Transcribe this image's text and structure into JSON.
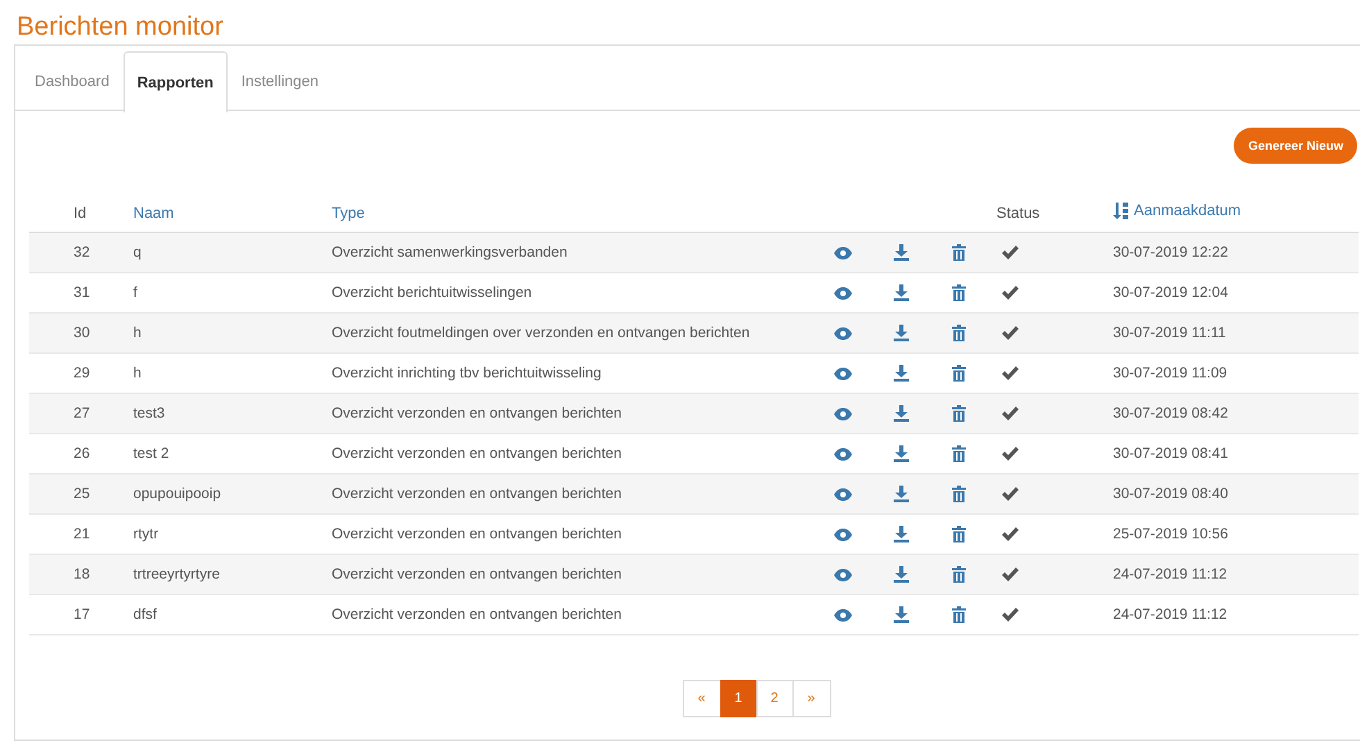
{
  "title": "Berichten monitor",
  "tabs": [
    {
      "label": "Dashboard",
      "selected": false
    },
    {
      "label": "Rapporten",
      "selected": true
    },
    {
      "label": "Instellingen",
      "selected": false
    }
  ],
  "generate_button": "Genereer Nieuw",
  "columns": [
    {
      "label": "Id",
      "link": false,
      "sorted": false
    },
    {
      "label": "Naam",
      "link": true,
      "sorted": false
    },
    {
      "label": "Type",
      "link": true,
      "sorted": false
    },
    {
      "label": "Status",
      "link": false,
      "sorted": false
    },
    {
      "label": "Aanmaakdatum",
      "link": true,
      "sorted": true
    }
  ],
  "rows": [
    {
      "id": "32",
      "name": "q",
      "type": "Overzicht samenwerkingsverbanden",
      "done": true,
      "date": "30-07-2019 12:22"
    },
    {
      "id": "31",
      "name": "f",
      "type": "Overzicht berichtuitwisselingen",
      "done": true,
      "date": "30-07-2019 12:04"
    },
    {
      "id": "30",
      "name": "h",
      "type": "Overzicht foutmeldingen over verzonden en ontvangen berichten",
      "done": true,
      "date": "30-07-2019 11:11"
    },
    {
      "id": "29",
      "name": "h",
      "type": "Overzicht inrichting tbv berichtuitwisseling",
      "done": true,
      "date": "30-07-2019 11:09"
    },
    {
      "id": "27",
      "name": "test3",
      "type": "Overzicht verzonden en ontvangen berichten",
      "done": true,
      "date": "30-07-2019 08:42"
    },
    {
      "id": "26",
      "name": "test 2",
      "type": "Overzicht verzonden en ontvangen berichten",
      "done": true,
      "date": "30-07-2019 08:41"
    },
    {
      "id": "25",
      "name": "opupouipooip",
      "type": "Overzicht verzonden en ontvangen berichten",
      "done": true,
      "date": "30-07-2019 08:40"
    },
    {
      "id": "21",
      "name": "rtytr",
      "type": "Overzicht verzonden en ontvangen berichten",
      "done": true,
      "date": "25-07-2019 10:56"
    },
    {
      "id": "18",
      "name": "trtreeyrtyrtyre",
      "type": "Overzicht verzonden en ontvangen berichten",
      "done": true,
      "date": "24-07-2019 11:12"
    },
    {
      "id": "17",
      "name": "dfsf",
      "type": "Overzicht verzonden en ontvangen berichten",
      "done": true,
      "date": "24-07-2019 11:12"
    }
  ],
  "pagination": {
    "prev": "«",
    "pages": [
      {
        "label": "1",
        "selected": true
      },
      {
        "label": "2",
        "selected": false
      }
    ],
    "next": "»"
  }
}
